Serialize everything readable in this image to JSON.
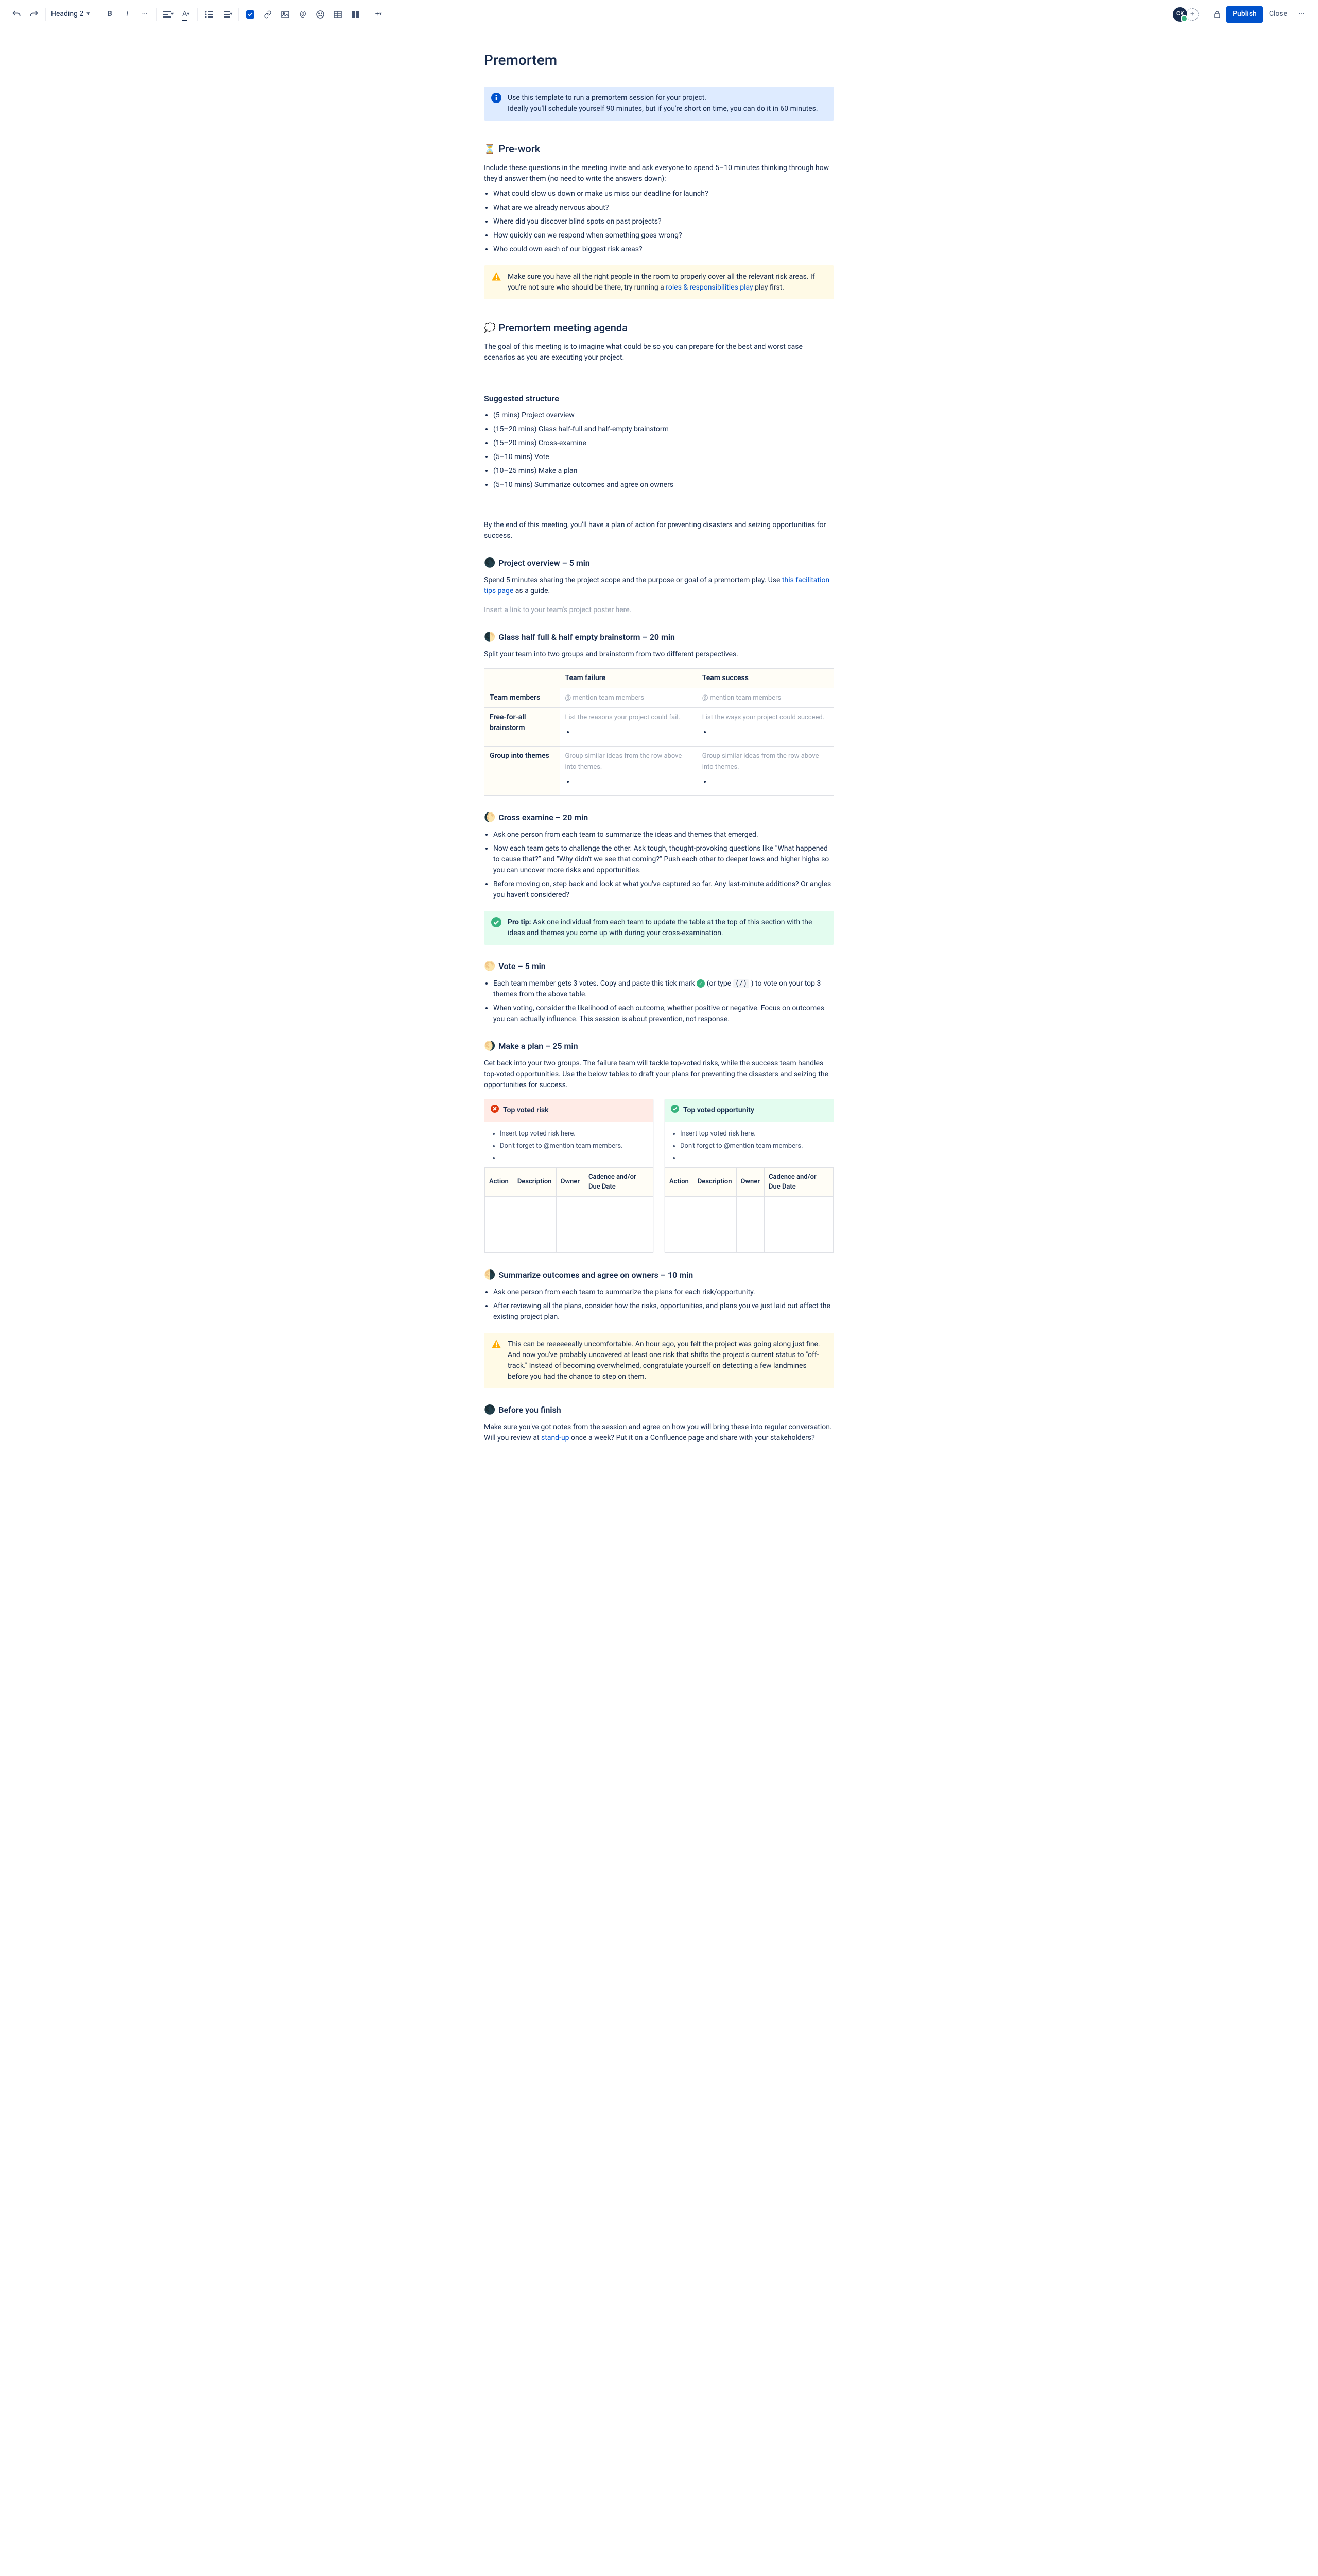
{
  "toolbar": {
    "heading_selector": "Heading 2",
    "avatar_initials": "CK",
    "publish": "Publish",
    "close": "Close"
  },
  "page_title": "Premortem",
  "info_panel": "Use this template to run a premortem session for your project.\nIdeally you'll schedule yourself 90 minutes, but if you're short on time, you can do it in 60 minutes.",
  "prework": {
    "heading": "Pre-work",
    "emoji": "⏳",
    "intro": "Include these questions in the meeting invite and ask everyone to spend 5–10 minutes thinking through how they'd answer them (no need to write the answers down):",
    "items": [
      "What could slow us down or make us miss our deadline for launch?",
      "What are we already nervous about?",
      "Where did you discover blind spots on past projects?",
      "How quickly can we respond when something goes wrong?",
      "Who could own each of our biggest risk areas?"
    ],
    "warning_pre": "Make sure you have all the right people in the room to properly cover all the relevant risk areas. If you're not sure who should be there, try running a ",
    "warning_link": "roles & responsibilities play",
    "warning_post": " play first."
  },
  "agenda": {
    "heading": "Premortem meeting agenda",
    "emoji": "💭",
    "intro": "The goal of this meeting is to imagine what could be so you can prepare for the best and worst case scenarios as you are executing your project.",
    "structure_heading": "Suggested structure",
    "items": [
      "(5 mins) Project overview",
      "(15–20 mins) Glass half-full and half-empty brainstorm",
      "(15–20 mins) Cross-examine",
      "(5–10 mins) Vote",
      "(10–25 mins) Make a plan",
      "(5–10 mins) Summarize outcomes and agree on owners"
    ],
    "outro": "By the end of this meeting, you'll have a plan of action for preventing disasters and seizing opportunities for success."
  },
  "overview": {
    "emoji": "🌑",
    "heading": "Project overview – 5 min",
    "text_pre": "Spend 5 minutes sharing the project scope and the purpose or goal of a premortem play. Use ",
    "text_link": "this facilitation tips page",
    "text_post": " as a guide.",
    "placeholder": "Insert a link to your team's project poster here."
  },
  "brainstorm": {
    "emoji": "🌓",
    "heading": "Glass half full & half empty brainstorm – 20 min",
    "intro": "Split your team into two groups and brainstorm from two different perspectives.",
    "cols": {
      "blank": " ",
      "fail": "Team failure",
      "success": "Team success"
    },
    "rows": {
      "members": {
        "label": "Team members",
        "fail": "@ mention team members",
        "success": "@ mention team members"
      },
      "freeforall": {
        "label": "Free-for-all brainstorm",
        "fail": "List the reasons your project could fail.",
        "success": "List the ways your project could succeed."
      },
      "group": {
        "label": "Group into themes",
        "fail": "Group similar ideas from the row above into themes.",
        "success": "Group similar ideas from the row above into themes."
      }
    }
  },
  "cross": {
    "emoji": "🌔",
    "heading": "Cross examine – 20 min",
    "items": [
      "Ask one person from each team to summarize the ideas and themes that emerged.",
      "Now each team gets to challenge the other. Ask tough, thought-provoking questions like “What happened to cause that?” and “Why didn't we see that coming?” Push each other to deeper lows and higher highs so you can uncover more risks and opportunities.",
      "Before moving on, step back and look at what you've captured so far. Any last-minute additions? Or angles you haven't considered?"
    ],
    "tip_label": "Pro tip:",
    "tip_body": " Ask one individual from each team to update the table at the top of this section with the ideas and themes you come up with during your cross-examination."
  },
  "vote": {
    "emoji": "🌕",
    "heading": "Vote – 5 min",
    "item1_pre": "Each team member gets 3 votes. Copy and paste this tick mark ",
    "item1_mid": " (or type ",
    "item1_code": "(/)",
    "item1_post": " ) to vote on your top 3 themes from the above table.",
    "item2": "When voting, consider the likelihood of each outcome, whether positive or negative. Focus on outcomes you can actually influence. This session is about prevention, not response."
  },
  "plan": {
    "emoji": "🌖",
    "heading": "Make a plan – 25 min",
    "intro": "Get back into your two groups. The failure team will tackle top-voted risks, while the success team handles top-voted opportunities. Use the below tables to draft your plans for preventing the disasters and seizing the opportunities for success.",
    "risk": {
      "title": "Top voted risk",
      "sub1": "Insert top voted risk here.",
      "sub2": "Don't forget to @mention team members."
    },
    "opp": {
      "title": "Top voted opportunity",
      "sub1": "Insert top voted risk here.",
      "sub2": "Don't forget to @mention team members."
    },
    "action_cols": {
      "action": "Action",
      "description": "Description",
      "owner": "Owner",
      "cadence": "Cadence and/or Due Date"
    }
  },
  "summarize": {
    "emoji": "🌗",
    "heading": "Summarize outcomes and agree on owners – 10 min",
    "items": [
      "Ask one person from each team to summarize the plans for each risk/opportunity.",
      "After reviewing all the plans, consider how the risks, opportunities, and plans you've just laid out affect the existing project plan."
    ],
    "warning": "This can be reeeeeeally uncomfortable. An hour ago, you felt the project was going along just fine. And now you've probably uncovered at least one risk that shifts the project's current status to \"off-track.\" Instead of becoming overwhelmed, congratulate yourself on detecting a few landmines before you had the chance to step on them."
  },
  "finish": {
    "emoji": "🌑",
    "heading": "Before you finish",
    "text_pre": "Make sure you've got notes from the session and agree on how you will bring these into regular conversation. Will you review at ",
    "text_link": "stand-up",
    "text_post": " once a week? Put it on a Confluence page and share with your stakeholders?"
  }
}
